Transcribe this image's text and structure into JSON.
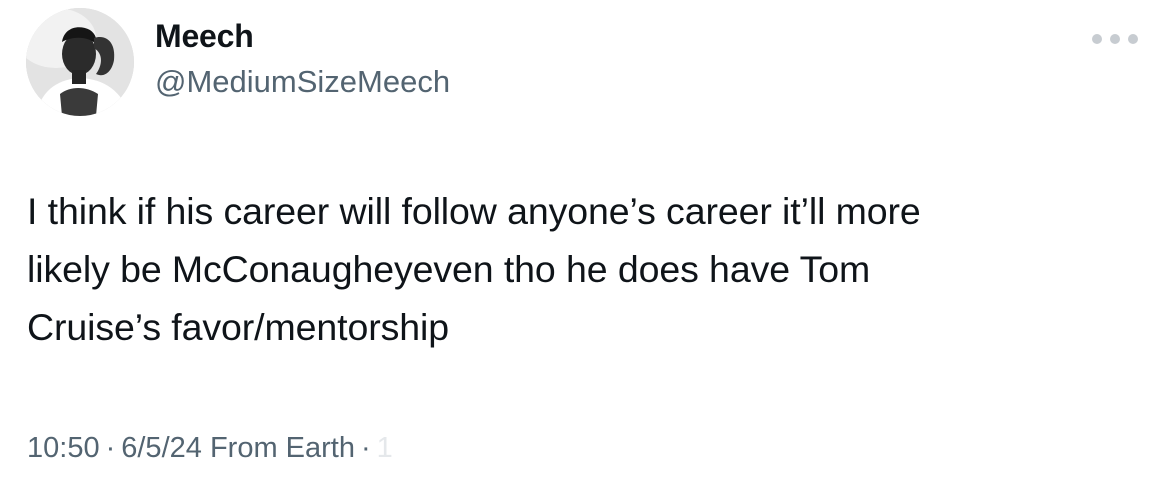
{
  "author": {
    "name": "Meech",
    "handle": "@MediumSizeMeech",
    "avatar_icon": "profile-photo"
  },
  "more_icon": "more-options-icon",
  "tweet": {
    "lines": [
      "I think if his career will follow anyone’s career it’ll more",
      "likely be McConaugheyeven tho he does have Tom",
      "Cruise’s favor/mentorship"
    ]
  },
  "meta": {
    "time": "10:50",
    "sep1": "·",
    "date": "6/5/24",
    "source": "From Earth",
    "sep2": "·",
    "faded": "1"
  },
  "colors": {
    "text": "#0f1419",
    "secondary": "#536471",
    "more_dots": "#c7ccd1"
  }
}
